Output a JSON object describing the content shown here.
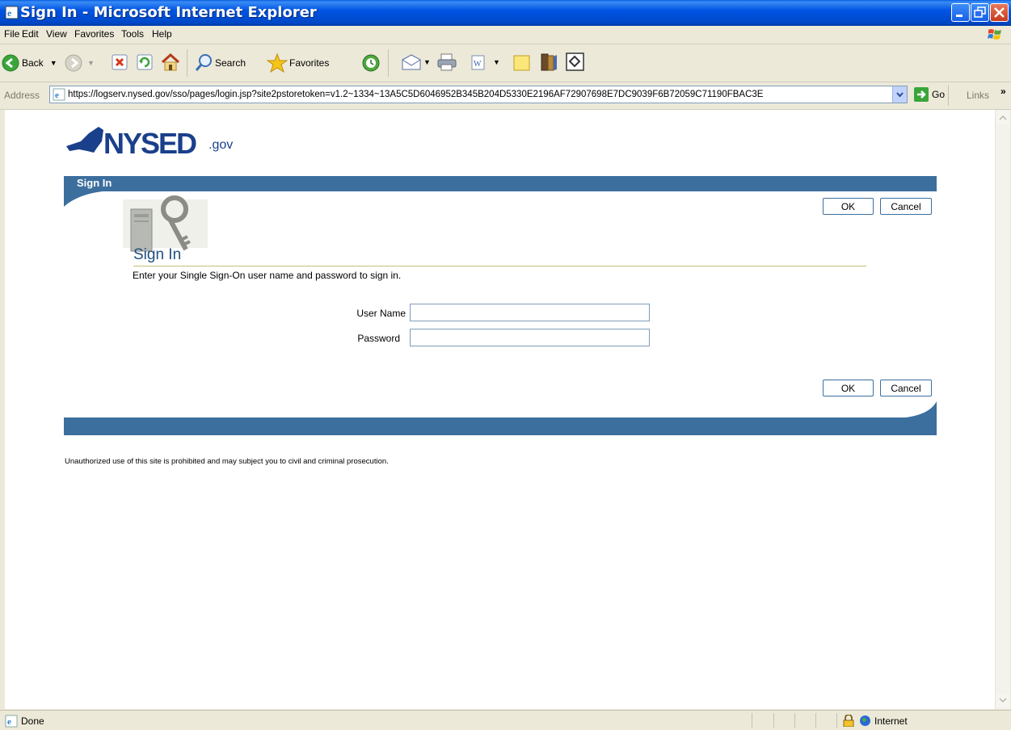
{
  "window": {
    "title": "Sign In - Microsoft Internet Explorer"
  },
  "menu": [
    "File",
    "Edit",
    "View",
    "Favorites",
    "Tools",
    "Help"
  ],
  "toolbar": {
    "back_label": "Back",
    "search_label": "Search",
    "favorites_label": "Favorites"
  },
  "address": {
    "label": "Address",
    "url": "https://logserv.nysed.gov/sso/pages/login.jsp?site2pstoretoken=v1.2~1334~13A5C5D6046952B345B204D5330E2196AF72907698E7DC9039F6B72059C71190FBAC3E",
    "go_label": "Go",
    "links_label": "Links"
  },
  "page": {
    "logo_main": "NYSED",
    "logo_suffix": ".gov",
    "band_title": "Sign In",
    "ok_label": "OK",
    "cancel_label": "Cancel",
    "section_title": "Sign In",
    "instructions": "Enter your Single Sign-On user name and password to sign in.",
    "username_label": "User Name",
    "password_label": "Password",
    "username_value": "",
    "password_value": "",
    "warning": "Unauthorized use of this site is prohibited and may subject you to civil and criminal prosecution."
  },
  "status": {
    "text": "Done",
    "zone": "Internet"
  },
  "colors": {
    "band": "#3c6e9e",
    "title_bar": "#0054e3",
    "logo": "#1a3f8b"
  }
}
